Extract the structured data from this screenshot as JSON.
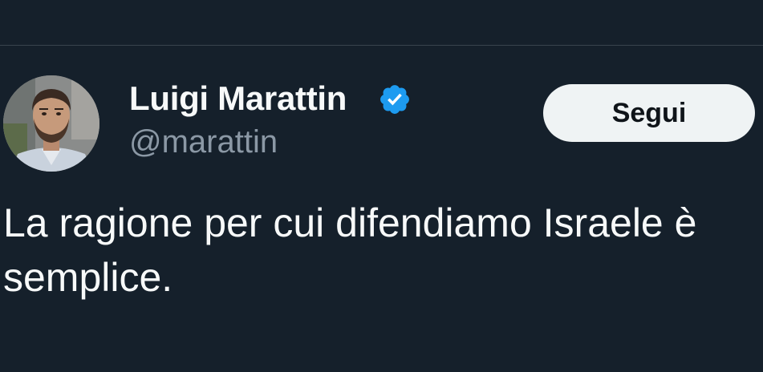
{
  "tweet": {
    "author": {
      "display_name": "Luigi Marattin",
      "handle": "@marattin",
      "verified": true,
      "verified_badge_icon": "verified-check-badge-icon",
      "avatar_icon": "profile-photo-avatar"
    },
    "follow_button": {
      "label": "Segui"
    },
    "text_lines": [
      "La ragione per cui difendiamo Israele è",
      "semplice."
    ]
  },
  "colors": {
    "background": "#15202b",
    "divider": "#38444d",
    "primary_text": "#f7f9f9",
    "secondary_text": "#8b98a5",
    "verified_blue": "#1d9bf0",
    "button_bg": "#eff3f4",
    "button_text": "#0f1419"
  }
}
